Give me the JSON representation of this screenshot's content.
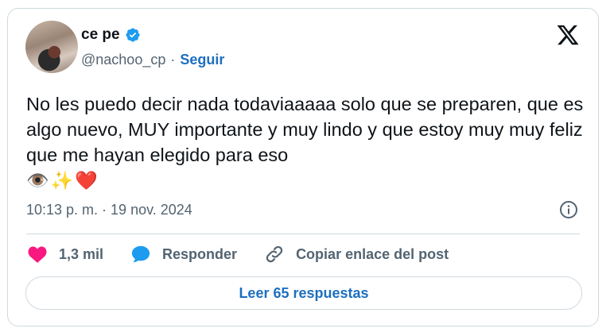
{
  "author": {
    "name": "ce pe",
    "handle": "@nachoo_cp",
    "separator": "·",
    "follow_label": "Seguir"
  },
  "tweet": {
    "text": "No les puedo decir nada todaviaaaaa solo que se preparen, que es algo nuevo, MUY importante y muy lindo y que estoy muy muy feliz que me hayan elegido para eso",
    "emojis": "👁️✨❤️",
    "timestamp": "10:13 p. m. · 19 nov. 2024"
  },
  "actions": {
    "likes_count": "1,3 mil",
    "reply_label": "Responder",
    "copy_link_label": "Copiar enlace del post"
  },
  "read_replies_label": "Leer 65 respuestas",
  "colors": {
    "accent": "#1d6fbf",
    "verified": "#1d9bf0",
    "heart": "#f91880",
    "text_secondary": "#536471",
    "border": "#cfd9de"
  },
  "icons": [
    "verified-badge-icon",
    "x-logo-icon",
    "info-icon",
    "heart-icon",
    "reply-bubble-icon",
    "link-icon"
  ]
}
